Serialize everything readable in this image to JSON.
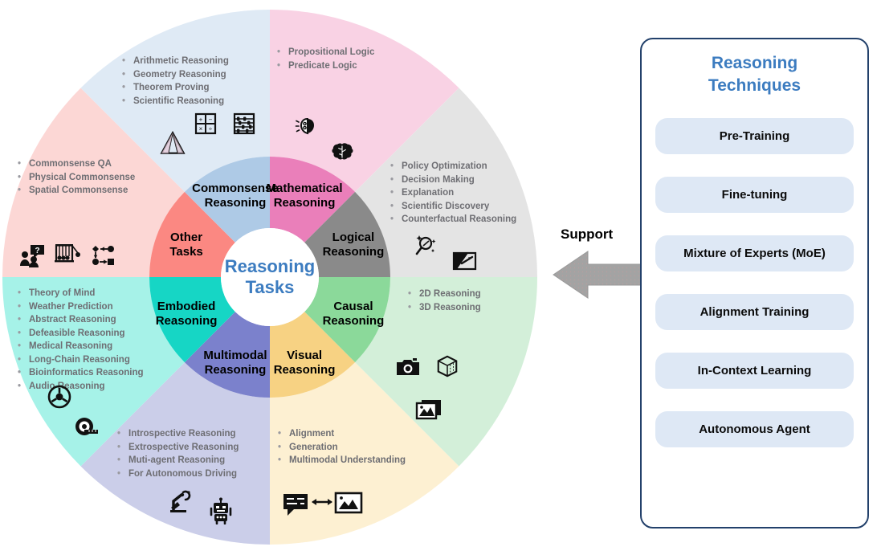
{
  "diagram": {
    "hub": {
      "line1": "Reasoning",
      "line2": "Tasks"
    },
    "sectors": [
      {
        "id": "mathematical-reasoning",
        "label_line1": "Mathematical",
        "label_line2": "Reasoning",
        "inner_color": "#ea7fba",
        "outer_color": "#f9d2e4",
        "bullets": [
          "Arithmetic Reasoning",
          "Geometry Reasoning",
          "Theorem Proving",
          "Scientific Reasoning"
        ],
        "icons": [
          "calculator-icon",
          "abacus-icon",
          "pyramid-icon"
        ]
      },
      {
        "id": "logical-reasoning",
        "label_line1": "Logical",
        "label_line2": "Reasoning",
        "inner_color": "#8a8a8a",
        "outer_color": "#e4e4e4",
        "bullets": [
          "Propositional Logic",
          "Predicate Logic"
        ],
        "icons": [
          "brain-idea-icon",
          "brain-icon"
        ]
      },
      {
        "id": "causal-reasoning",
        "label_line1": "Causal",
        "label_line2": "Reasoning",
        "inner_color": "#8bd99a",
        "outer_color": "#d3efd9",
        "bullets": [
          "Policy Optimization",
          "Decision Making",
          "Explanation",
          "Scientific Discovery",
          "Counterfactual Reasoning"
        ],
        "icons": [
          "magnifier-sparkle-icon",
          "presentation-pointer-icon"
        ]
      },
      {
        "id": "visual-reasoning",
        "label_line1": "Visual",
        "label_line2": "Reasoning",
        "inner_color": "#f7d283",
        "outer_color": "#fdf0d2",
        "bullets": [
          "2D Reasoning",
          "3D Reasoning"
        ],
        "icons": [
          "camera-icon",
          "cube-icon",
          "images-icon"
        ]
      },
      {
        "id": "multimodal-reasoning",
        "label_line1": "Multimodal",
        "label_line2": "Reasoning",
        "inner_color": "#7b81cc",
        "outer_color": "#cbcee9",
        "bullets": [
          "Alignment",
          "Generation",
          "Multimodal Understanding"
        ],
        "icons": [
          "chat-image-exchange-icon"
        ]
      },
      {
        "id": "embodied-reasoning",
        "label_line1": "Embodied",
        "label_line2": "Reasoning",
        "inner_color": "#16d6c5",
        "outer_color": "#a6f2e8",
        "bullets": [
          "Introspective Reasoning",
          "Extrospective Reasoning",
          "Muti-agent Reasoning",
          "For Autonomous Driving"
        ],
        "icons": [
          "robot-arm-icon",
          "robot-icon"
        ]
      },
      {
        "id": "other-tasks",
        "label_line1": "Other",
        "label_line2": "Tasks",
        "inner_color": "#fb8882",
        "outer_color": "#fcd7d5",
        "bullets": [
          "Theory of Mind",
          "Weather Prediction",
          "Abstract Reasoning",
          "Defeasible Reasoning",
          "Medical Reasoning",
          "Long-Chain Reasoning",
          "Bioinformatics Reasoning",
          "Audio Reasoning"
        ],
        "icons": [
          "steering-wheel-icon",
          "tape-measure-icon"
        ]
      },
      {
        "id": "commonsense-reasoning",
        "label_line1": "Commonsense",
        "label_line2": "Reasoning",
        "inner_color": "#aecae6",
        "outer_color": "#dfeaf5",
        "bullets": [
          "Commonsense QA",
          "Physical Commonsense",
          "Spatial Commonsense"
        ],
        "icons": [
          "people-question-icon",
          "newtons-cradle-icon",
          "flow-nodes-icon"
        ]
      }
    ]
  },
  "support": {
    "label": "Support",
    "arrow_icon": "left-arrow-icon",
    "arrow_color": "#a3a3a3"
  },
  "techniques_panel": {
    "title_line1": "Reasoning",
    "title_line2": "Techniques",
    "accent_color": "#3c7cc0",
    "border_color": "#23416b",
    "item_bg": "#dee8f5",
    "items": [
      "Pre-Training",
      "Fine-tuning",
      "Mixture of Experts (MoE)",
      "Alignment Training",
      "In-Context Learning",
      "Autonomous Agent"
    ]
  }
}
